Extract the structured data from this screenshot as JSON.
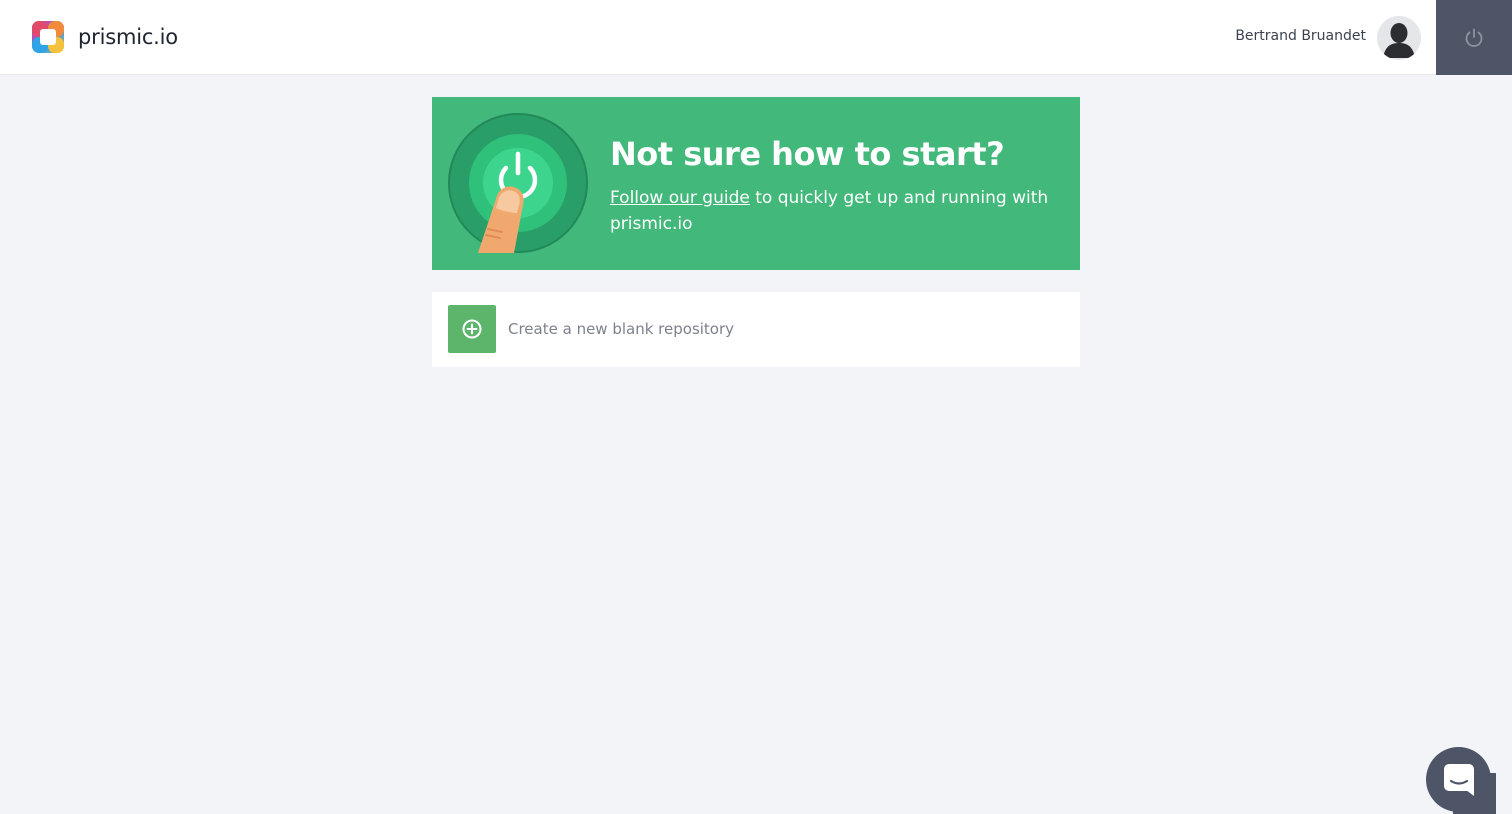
{
  "header": {
    "brand_name": "prismic.io",
    "user_name": "Bertrand Bruandet"
  },
  "banner": {
    "title": "Not sure how to start?",
    "link_text": "Follow our guide",
    "text_after_link": " to quickly get up and running with prismic.io"
  },
  "new_repository": {
    "label": "Create a new blank repository"
  },
  "colors": {
    "banner_green": "#42b97a",
    "button_green": "#5cb56b",
    "dark_slate": "#4d5566",
    "page_background": "#f2f4f7"
  },
  "icons": {
    "logo": "prismic-logo-icon",
    "avatar": "user-silhouette-icon",
    "logout": "power-icon",
    "illustration": "power-button-finger-icon",
    "add": "plus-circle-icon",
    "chat": "chat-bubble-icon"
  }
}
